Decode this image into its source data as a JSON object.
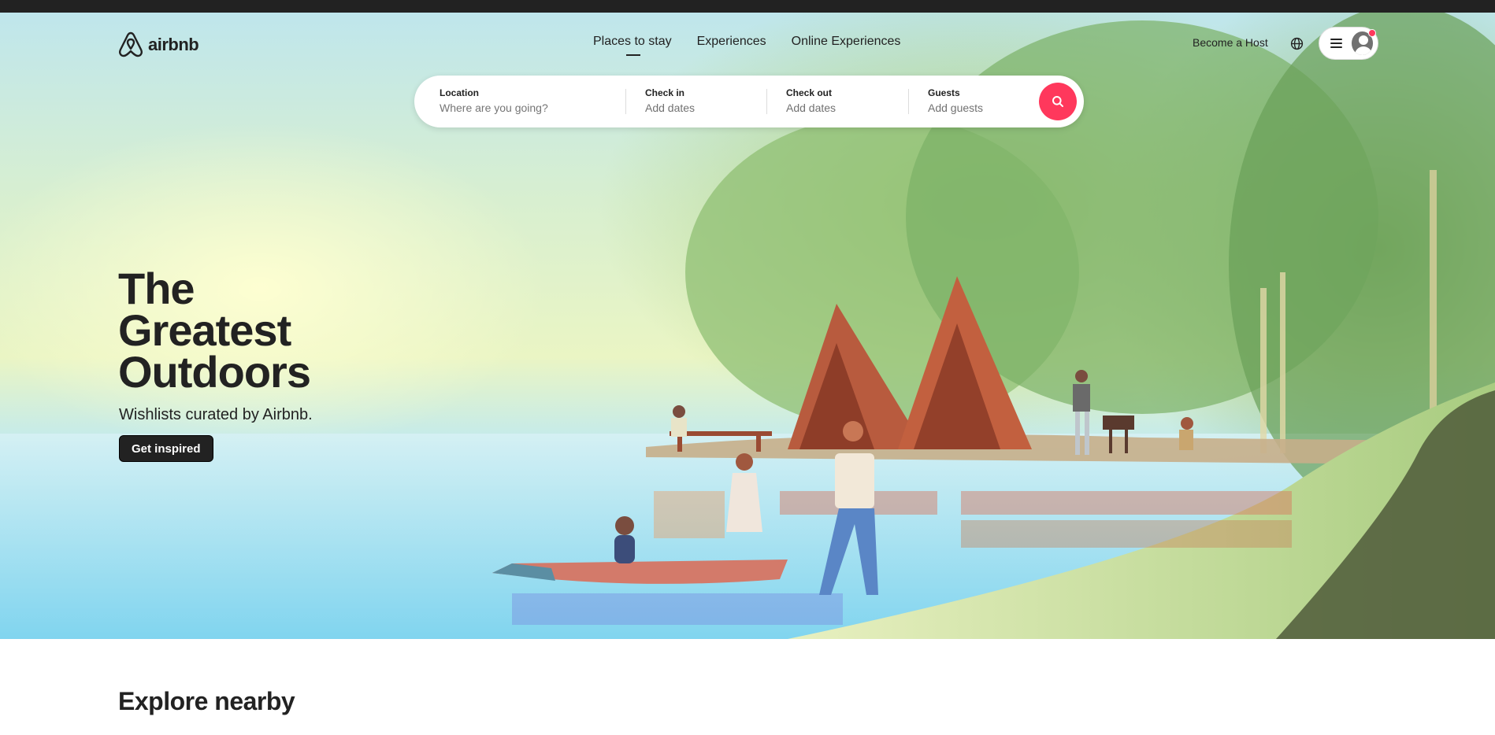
{
  "brand": {
    "name": "airbnb",
    "accent": "#ff385c",
    "dark": "#222222"
  },
  "nav": {
    "items": [
      {
        "label": "Places to stay",
        "active": true
      },
      {
        "label": "Experiences",
        "active": false
      },
      {
        "label": "Online Experiences",
        "active": false
      }
    ]
  },
  "header_right": {
    "host_label": "Become a Host",
    "globe_icon": "globe-icon",
    "menu_icon": "hamburger-icon",
    "avatar_icon": "user-avatar-icon",
    "has_notification": true
  },
  "search": {
    "location": {
      "label": "Location",
      "placeholder": "Where are you going?"
    },
    "check_in": {
      "label": "Check in",
      "placeholder": "Add dates"
    },
    "check_out": {
      "label": "Check out",
      "placeholder": "Add dates"
    },
    "guests": {
      "label": "Guests",
      "placeholder": "Add guests"
    },
    "button_icon": "search-icon"
  },
  "hero": {
    "title_line1": "The",
    "title_line2": "Greatest",
    "title_line3": "Outdoors",
    "subtitle": "Wishlists curated by Airbnb.",
    "cta_label": "Get inspired"
  },
  "sections": {
    "explore_title": "Explore nearby"
  }
}
